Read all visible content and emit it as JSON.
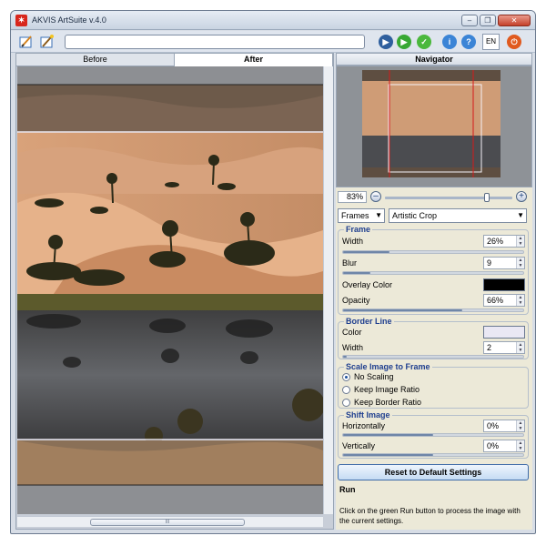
{
  "window": {
    "title": "AKVIS ArtSuite v.4.0",
    "controls": [
      "–",
      "❐",
      "✕"
    ]
  },
  "toolbar": {
    "language": "EN"
  },
  "view": {
    "tabs": [
      {
        "label": "Before",
        "active": false
      },
      {
        "label": "After",
        "active": true
      }
    ],
    "scroll_grip": "III"
  },
  "panel": {
    "navigator_title": "Navigator",
    "zoom": "83%",
    "zoom_out": "–",
    "zoom_in": "+",
    "zoom_level": 0.8,
    "category": "Frames",
    "effect": "Artistic Crop",
    "frame": {
      "title": "Frame",
      "width_label": "Width",
      "width_value": "26%",
      "width_fraction": 0.26,
      "blur_label": "Blur",
      "blur_value": "9",
      "blur_fraction": 0.15,
      "overlay_color_label": "Overlay Color",
      "overlay_color": "#000000",
      "opacity_label": "Opacity",
      "opacity_value": "66%",
      "opacity_fraction": 0.66
    },
    "border_line": {
      "title": "Border Line",
      "color_label": "Color",
      "color": "#eae8f4",
      "width_label": "Width",
      "width_value": "2",
      "width_fraction": 0.02
    },
    "scale": {
      "title": "Scale Image to Frame",
      "options": [
        {
          "label": "No Scaling",
          "selected": true
        },
        {
          "label": "Keep Image Ratio",
          "selected": false
        },
        {
          "label": "Keep Border Ratio",
          "selected": false
        }
      ]
    },
    "shift": {
      "title": "Shift Image",
      "horizontal_label": "Horizontally",
      "horizontal_value": "0%",
      "horizontal_fraction": 0.5,
      "vertical_label": "Vertically",
      "vertical_value": "0%",
      "vertical_fraction": 0.5
    },
    "reset_label": "Reset to Default Settings",
    "run_title": "Run",
    "run_description": "Click on the green Run button to process the image with the current settings."
  },
  "colors": {
    "run_green": "#38a833",
    "accept_green": "#4ab83c",
    "play_blue": "#2f5f9e",
    "info_blue": "#3b84d6",
    "power_orange": "#e05a1f",
    "group_title_blue": "#1f3f8f"
  }
}
